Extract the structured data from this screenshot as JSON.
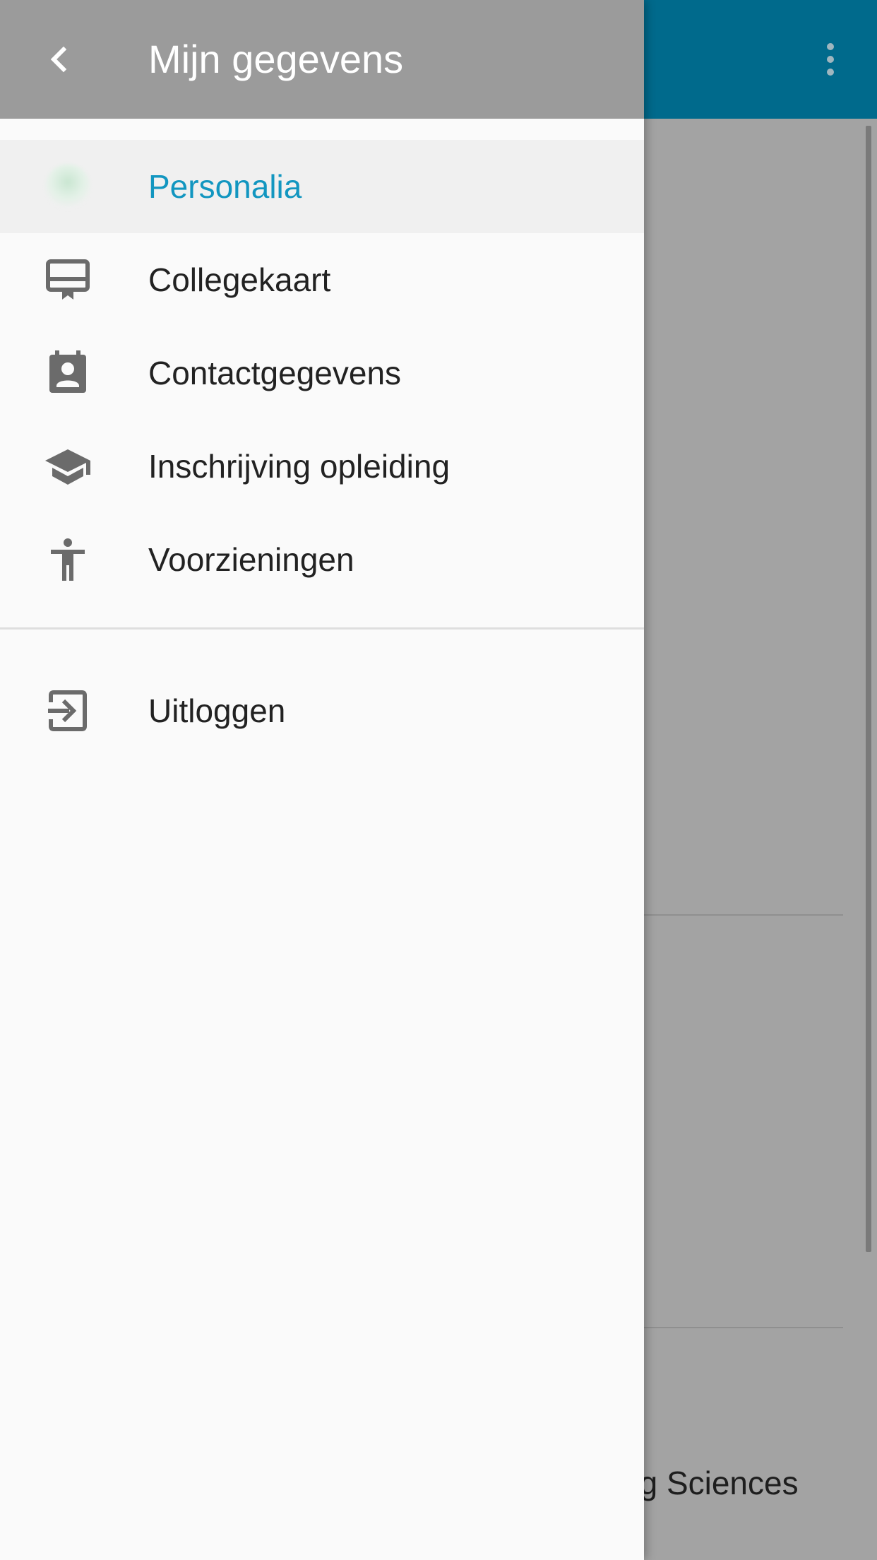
{
  "drawer": {
    "title": "Mijn gegevens",
    "items": [
      {
        "label": "Personalia",
        "icon": "avatar-icon",
        "active": true
      },
      {
        "label": "Collegekaart",
        "icon": "card-icon",
        "active": false
      },
      {
        "label": "Contactgegevens",
        "icon": "contact-icon",
        "active": false
      },
      {
        "label": "Inschrijving opleiding",
        "icon": "school-icon",
        "active": false
      },
      {
        "label": "Voorzieningen",
        "icon": "accessibility-icon",
        "active": false
      }
    ],
    "logout": {
      "label": "Uitloggen",
      "icon": "logout-icon"
    }
  },
  "underlay": {
    "partial_text": "ng Sciences"
  },
  "colors": {
    "app_bar": "#006a8c",
    "drawer_header": "#9b9b9b",
    "active_text": "#1296c0",
    "icon_gray": "#6b6b6b"
  }
}
